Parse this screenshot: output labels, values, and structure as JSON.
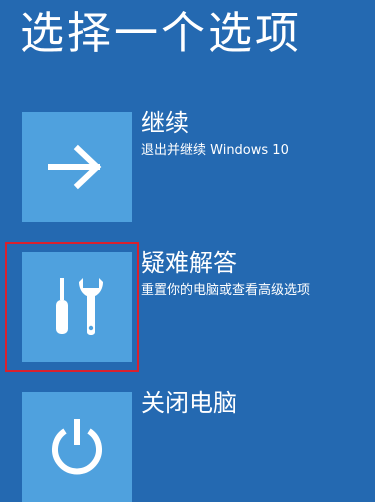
{
  "title": "选择一个选项",
  "options": [
    {
      "title": "继续",
      "desc": "退出并继续 Windows 10",
      "icon": "arrow-right-icon"
    },
    {
      "title": "疑难解答",
      "desc": "重置你的电脑或查看高级选项",
      "icon": "tools-icon"
    },
    {
      "title": "关闭电脑",
      "desc": "",
      "icon": "power-icon"
    }
  ],
  "colors": {
    "background": "#2469b1",
    "tile": "#4fa1de",
    "highlight": "#d8212e",
    "text": "#ffffff"
  }
}
